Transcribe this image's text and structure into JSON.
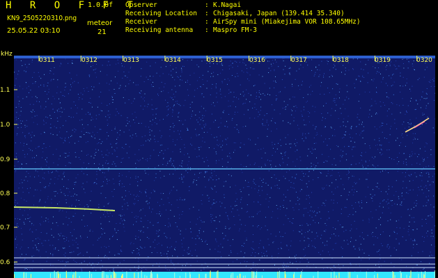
{
  "header": {
    "brand": "H R O F F T",
    "version": "1.0.0f",
    "filename": "KN9_2505220310.png",
    "datetime": "25.05.22 03:10",
    "meteor_label": "meteor",
    "meteor_count": "21",
    "info": [
      {
        "key": "Observer",
        "value": "K.Nagai"
      },
      {
        "key": "Receiving Location",
        "value": "Chigasaki, Japan (139.414 35.340)"
      },
      {
        "key": "Receiver",
        "value": "AirSpy mini (Miakejima VOR 108.65MHz)"
      },
      {
        "key": "Receiving antenna",
        "value": "Maspro FM-3"
      }
    ]
  },
  "axis": {
    "unit": "kHz",
    "y_ticks": [
      "1.1",
      "1.0",
      "0.9",
      "0.8",
      "0.7",
      "0.6"
    ],
    "x_labels": [
      "0311",
      "0312",
      "0313",
      "0314",
      "0315",
      "0316",
      "0317",
      "0318",
      "0319",
      "0320"
    ]
  },
  "colors": {
    "background": "#101a66",
    "text": "#ffff00",
    "carrier": "#66ccff",
    "meteor": "#ddff66"
  }
}
